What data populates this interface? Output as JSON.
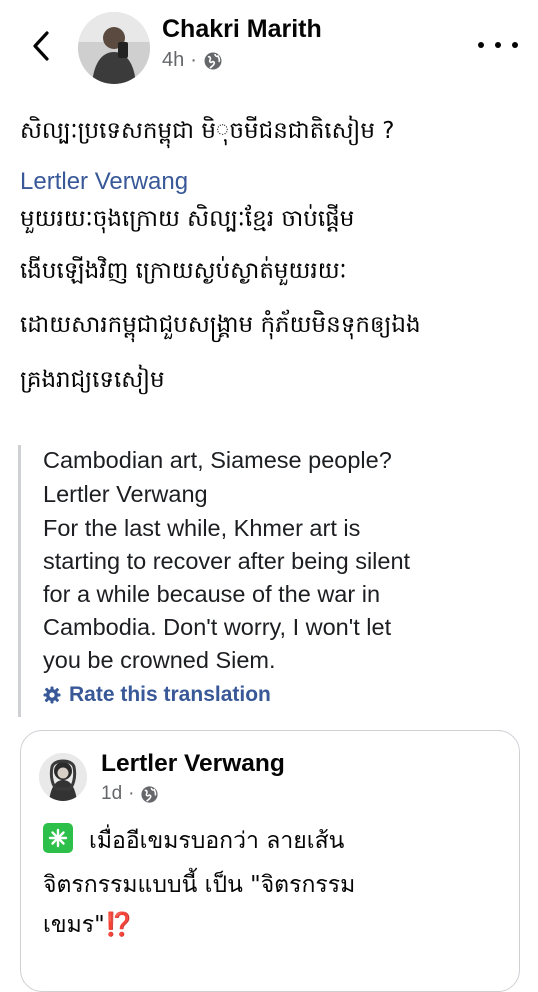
{
  "header": {
    "author": "Chakri Marith",
    "time": "4h",
    "dot": "·",
    "audience_icon": "globe-icon",
    "back_icon": "chevron-left-icon",
    "more_icon": "more-horizontal-icon"
  },
  "post": {
    "title": "សិល្បៈប្រទេសកម្ពុជា មិុចមីជនជាតិសៀម ?",
    "mention": "Lertler Verwang",
    "body_lines": [
      "មួយរយៈចុងក្រោយ សិល្បៈខ្មែរ ចាប់ផ្តើម",
      "ងើបឡើងវិញ ក្រោយស្ងប់ស្ងាត់មួយរយៈ",
      "ដោយសារកម្ពុជាជួបសង្គ្រាម កុំភ័យមិនទុកឲ្យឯង",
      "គ្រងរាជ្យទេសៀម"
    ]
  },
  "translation": {
    "title": "Cambodian art, Siamese people?",
    "mention": "Lertler Verwang",
    "lines": [
      "For the last while, Khmer art is",
      "starting to recover after being silent",
      "for a while because of the war in",
      "Cambodia. Don't worry, I won't let",
      "you be crowned Siem."
    ],
    "rate_label": "Rate this translation",
    "rate_icon": "gear-icon"
  },
  "quoted": {
    "author": "Lertler Verwang",
    "time": "1d",
    "dot": "·",
    "audience_icon": "globe-icon",
    "lines": [
      "เมื่ออีเขมรบอกว่า ลายเส้น",
      "จิตรกรรมแบบนี้ เป็น \"จิตรกรรม",
      "เขมร\""
    ],
    "emoji_sparkle": "sparkle-icon",
    "emoji_end": "⁉️"
  }
}
